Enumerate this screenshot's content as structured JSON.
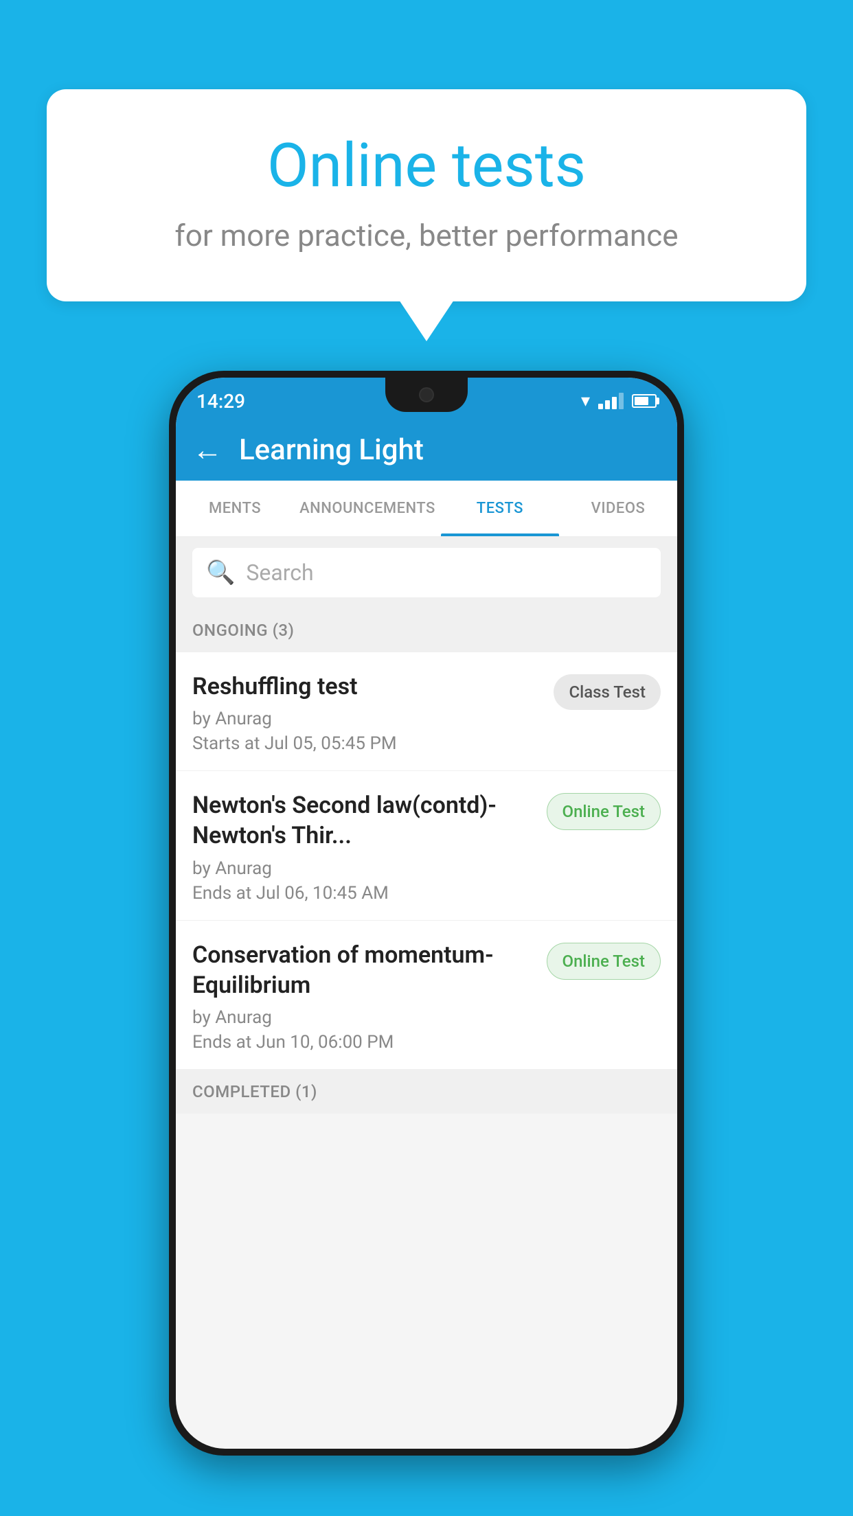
{
  "background": {
    "color": "#1ab3e8"
  },
  "speech_bubble": {
    "title": "Online tests",
    "subtitle": "for more practice, better performance"
  },
  "phone": {
    "status_bar": {
      "time": "14:29"
    },
    "app_bar": {
      "title": "Learning Light"
    },
    "tabs": [
      {
        "label": "MENTS",
        "active": false
      },
      {
        "label": "ANNOUNCEMENTS",
        "active": false
      },
      {
        "label": "TESTS",
        "active": true
      },
      {
        "label": "VIDEOS",
        "active": false
      }
    ],
    "search": {
      "placeholder": "Search"
    },
    "sections": [
      {
        "title": "ONGOING (3)",
        "tests": [
          {
            "name": "Reshuffling test",
            "author": "by Anurag",
            "date": "Starts at  Jul 05, 05:45 PM",
            "badge": "Class Test",
            "badge_type": "class"
          },
          {
            "name": "Newton's Second law(contd)-Newton's Thir...",
            "author": "by Anurag",
            "date": "Ends at  Jul 06, 10:45 AM",
            "badge": "Online Test",
            "badge_type": "online"
          },
          {
            "name": "Conservation of momentum-Equilibrium",
            "author": "by Anurag",
            "date": "Ends at  Jun 10, 06:00 PM",
            "badge": "Online Test",
            "badge_type": "online"
          }
        ]
      },
      {
        "title": "COMPLETED (1)",
        "tests": []
      }
    ]
  }
}
